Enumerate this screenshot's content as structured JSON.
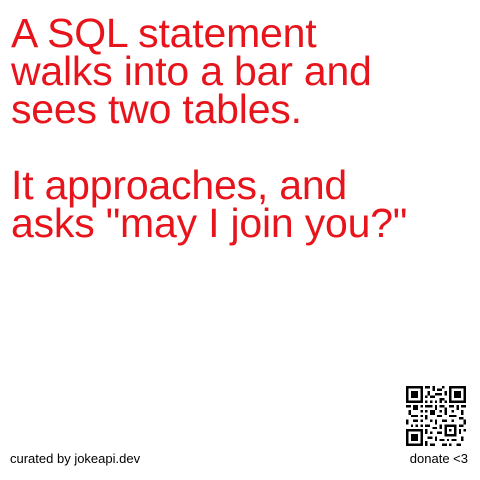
{
  "joke": {
    "setup_lines": [
      "A SQL statement",
      "walks into a bar and",
      "sees two tables."
    ],
    "delivery_lines": [
      "It approaches, and",
      "asks \"may I join you?\""
    ]
  },
  "footer": {
    "credit": "curated by jokeapi.dev",
    "donate": "donate <3"
  },
  "icons": {
    "qr": "qr-code-icon"
  },
  "colors": {
    "joke_text": "#e8141c",
    "footer_text": "#000000",
    "background": "#ffffff"
  }
}
